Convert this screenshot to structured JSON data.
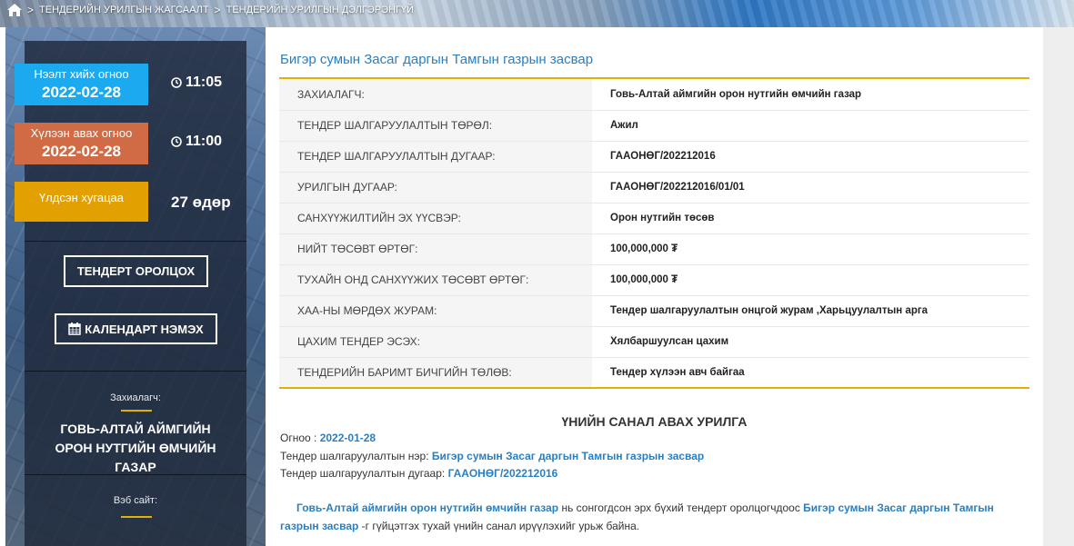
{
  "breadcrumb": {
    "items": [
      "ТЕНДЕРИЙН УРИЛГЫН ЖАГСААЛТ",
      "ТЕНДЕРИЙН УРИЛГЫН ДЭЛГЭРЭНГҮЙ"
    ],
    "separator": ">"
  },
  "sidebar": {
    "open_date": {
      "label": "Нээлт хийх огноо",
      "date": "2022-02-28",
      "time": "11:05"
    },
    "close_date": {
      "label": "Хүлээн авах огноо",
      "date": "2022-02-28",
      "time": "11:00"
    },
    "remaining": {
      "label": "Үлдсэн хугацаа",
      "value": "27 өдөр"
    },
    "bid_button": "ТЕНДЕРТ ОРОЛЦОХ",
    "calendar_button": "КАЛЕНДАРТ НЭМЭХ",
    "customer_label": "Захиалагч:",
    "customer_name": "ГОВЬ-АЛТАЙ АЙМГИЙН ОРОН НУТГИЙН ӨМЧИЙН ГАЗАР",
    "website_label": "Вэб сайт:"
  },
  "main": {
    "title": "Бигэр сумын Засаг даргын Тамгын газрын засвар",
    "rows": [
      {
        "key": "ЗАХИАЛАГЧ:",
        "value": "Говь-Алтай аймгийн орон нутгийн өмчийн газар"
      },
      {
        "key": "ТЕНДЕР ШАЛГАРУУЛАЛТЫН ТӨРӨЛ:",
        "value": "Ажил"
      },
      {
        "key": "ТЕНДЕР ШАЛГАРУУЛАЛТЫН ДУГААР:",
        "value": "ГААОНӨГ/202212016"
      },
      {
        "key": "УРИЛГЫН ДУГААР:",
        "value": "ГААОНӨГ/202212016/01/01"
      },
      {
        "key": "САНХҮҮЖИЛТИЙН ЭХ ҮҮСВЭР:",
        "value": "Орон нутгийн төсөв"
      },
      {
        "key": "НИЙТ ТӨСӨВТ ӨРТӨГ:",
        "value": "100,000,000 ₮"
      },
      {
        "key": "ТУХАЙН ОНД САНХҮҮЖИХ ТӨСӨВТ ӨРТӨГ:",
        "value": "100,000,000 ₮"
      },
      {
        "key": "ХАА-НЫ МӨРДӨХ ЖУРАМ:",
        "value": "Тендер шалгаруулалтын онцгой журам ,Харьцуулалтын арга"
      },
      {
        "key": "ЦАХИМ ТЕНДЕР ЭСЭХ:",
        "value": "Хялбаршуулсан цахим"
      },
      {
        "key": "ТЕНДЕРИЙН БАРИМТ БИЧГИЙН ТӨЛӨВ:",
        "value": "Тендер хүлээн авч байгаа"
      }
    ],
    "section_title": "ҮНИЙН САНАЛ АВАХ УРИЛГА",
    "date_label": "Огноо :",
    "date_value": "2022-01-28",
    "name_label": "Тендер шалгаруулалтын нэр:",
    "name_value": "Бигэр сумын Засаг даргын Тамгын газрын засвар",
    "number_label": "Тендер шалгаруулалтын дугаар:",
    "number_value": "ГААОНӨГ/202212016",
    "para_org": "Говь-Алтай аймгийн орон нутгийн өмчийн газар",
    "para_mid": "нь сонгогдсон эрх бүхий тендерт оролцогчдоос",
    "para_project": "Бигэр сумын Засаг даргын Тамгын газрын засвар",
    "para_end": "-г гүйцэтгэх тухай үнийн санал ирүүлэхийг урьж байна."
  }
}
